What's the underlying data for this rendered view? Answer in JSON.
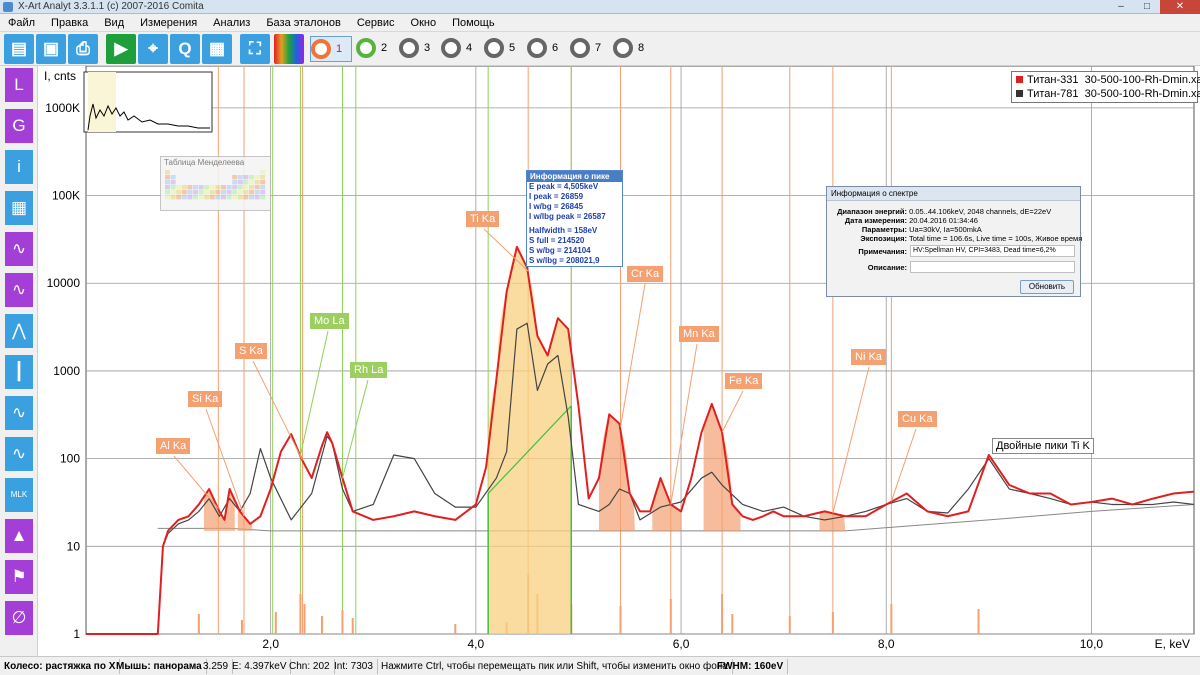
{
  "window": {
    "title": "X-Art Analyt 3.3.1.1 (c) 2007-2016 Comita",
    "min": "–",
    "max": "□",
    "close": "✕"
  },
  "menu": [
    "Файл",
    "Правка",
    "Вид",
    "Измерения",
    "Анализ",
    "База эталонов",
    "Сервис",
    "Окно",
    "Помощь"
  ],
  "toolbar": {
    "icons": [
      "open-folder-icon",
      "save-icon",
      "print-icon",
      "play-icon",
      "target-icon",
      "search-q-icon",
      "calculator-icon",
      "fullscreen-icon",
      "color-palette-icon"
    ],
    "glyphs": [
      "▤",
      "▣",
      "⎙",
      "▶",
      "⌖",
      "Q",
      "▦",
      "⛶",
      "█"
    ],
    "spectra": [
      {
        "num": "1",
        "color": "orange",
        "selected": true
      },
      {
        "num": "2",
        "color": "green",
        "selected": false
      },
      {
        "num": "3",
        "color": "gray",
        "selected": false
      },
      {
        "num": "4",
        "color": "gray",
        "selected": false
      },
      {
        "num": "5",
        "color": "gray",
        "selected": false
      },
      {
        "num": "6",
        "color": "gray",
        "selected": false
      },
      {
        "num": "7",
        "color": "gray",
        "selected": false
      },
      {
        "num": "8",
        "color": "gray",
        "selected": false
      }
    ]
  },
  "sidebar": {
    "buttons": [
      {
        "label": "L",
        "icon": "l-button-icon",
        "color": "purple"
      },
      {
        "label": "G",
        "icon": "g-button-icon",
        "color": "purple"
      },
      {
        "label": "i",
        "icon": "info-icon",
        "color": "blue"
      },
      {
        "label": "▦",
        "icon": "table-icon",
        "color": "blue"
      },
      {
        "label": "∿",
        "icon": "peak-icon",
        "color": "purple"
      },
      {
        "label": "∿",
        "icon": "peak-line-icon",
        "color": "purple"
      },
      {
        "label": "⋀",
        "icon": "peak-markers-icon",
        "color": "blue"
      },
      {
        "label": "┃",
        "icon": "bars-icon",
        "color": "blue"
      },
      {
        "label": "∿",
        "icon": "peak-fill-icon",
        "color": "blue"
      },
      {
        "label": "∿",
        "icon": "peak-outline-icon",
        "color": "blue"
      },
      {
        "label": "MLK",
        "icon": "mlk-lines-icon",
        "color": "blue"
      },
      {
        "label": "▲",
        "icon": "area-icon",
        "color": "purple"
      },
      {
        "label": "⚑",
        "icon": "flag-icon",
        "color": "purple"
      },
      {
        "label": "∅",
        "icon": "no-marker-icon",
        "color": "purple"
      }
    ]
  },
  "legend": [
    {
      "name": "Титан-331",
      "file": "30-500-100-Rh-Dmin.xart",
      "color": "#e02020"
    },
    {
      "name": "Титан-781",
      "file": "30-500-100-Rh-Dmin.xart",
      "color": "#333333"
    }
  ],
  "periodic_table": {
    "title": "Таблица Менделеева"
  },
  "peak_info": {
    "title": "Информация о пике",
    "lines": [
      "E peak = 4,505keV",
      "I peak = 26859",
      "I w/bg = 26845",
      "I w/lbg peak = 26587",
      "Halfwidth = 158eV",
      "S full = 214520",
      "S w/bg = 214104",
      "S w/lbg = 208021,9"
    ]
  },
  "spectrum_info": {
    "title": "Информация о спектре",
    "rows": [
      {
        "label": "Диапазон энергий:",
        "value": "0.05..44.106keV, 2048 channels, dE=22eV"
      },
      {
        "label": "Дата измерения:",
        "value": "20.04.2016 01:34:46"
      },
      {
        "label": "Параметры:",
        "value": "Ua=30kV, Ia=500mkA"
      },
      {
        "label": "Экспозиция:",
        "value": "Total time = 106.6s, Live time = 100s, Живое время"
      }
    ],
    "notes_label": "Примечания:",
    "notes_value": "HV:Spellman HV, CPI=3483, Dead time=6,2%",
    "desc_label": "Описание:",
    "desc_value": "",
    "update_button": "Обновить"
  },
  "statusbar": [
    "Колесо: растяжка по Х",
    "Мышь: панорама",
    "3.259",
    "E: 4.397keV",
    "Chn: 202",
    "Int: 7303",
    "Нажмите Ctrl, чтобы перемещать пик или Shift, чтобы изменить окно фона",
    "FWHM: 160eV"
  ],
  "chart_data": {
    "type": "line",
    "xlabel": "E, keV",
    "ylabel": "I, cnts",
    "xlim": [
      0.2,
      11.0
    ],
    "ylim": [
      1,
      3000000
    ],
    "yscale": "log",
    "xticks": [
      2.0,
      4.0,
      6.0,
      8.0,
      10.0
    ],
    "xtick_labels": [
      "2,0",
      "4,0",
      "6,0",
      "8,0",
      "10,0"
    ],
    "yticks": [
      1,
      10,
      100,
      1000,
      10000,
      100000,
      1000000
    ],
    "ytick_labels": [
      "1",
      "10",
      "100",
      "1000",
      "10000",
      "100K",
      "1000K"
    ],
    "grid": true,
    "legend_position": "top-right",
    "series": [
      {
        "name": "Титан-331",
        "color": "#e02020",
        "x": [
          0.2,
          0.9,
          0.95,
          1.0,
          1.1,
          1.2,
          1.3,
          1.4,
          1.5,
          1.55,
          1.6,
          1.7,
          1.8,
          1.9,
          2.0,
          2.1,
          2.2,
          2.3,
          2.4,
          2.5,
          2.55,
          2.6,
          2.7,
          2.8,
          3.0,
          3.2,
          3.4,
          3.6,
          3.8,
          4.0,
          4.1,
          4.2,
          4.3,
          4.4,
          4.5,
          4.6,
          4.7,
          4.8,
          4.9,
          5.0,
          5.1,
          5.2,
          5.3,
          5.4,
          5.5,
          5.6,
          5.7,
          5.8,
          5.9,
          6.0,
          6.1,
          6.2,
          6.3,
          6.4,
          6.5,
          6.6,
          6.7,
          6.8,
          6.9,
          7.0,
          7.2,
          7.4,
          7.6,
          7.8,
          8.0,
          8.2,
          8.4,
          8.6,
          8.8,
          9.0,
          9.2,
          9.4,
          9.6,
          9.8,
          10.0,
          10.2,
          10.4,
          10.6,
          10.8,
          11.0
        ],
        "y": [
          1,
          1,
          10,
          15,
          20,
          22,
          30,
          45,
          25,
          20,
          45,
          25,
          18,
          22,
          45,
          120,
          190,
          100,
          60,
          140,
          200,
          150,
          60,
          25,
          20,
          22,
          25,
          22,
          20,
          30,
          80,
          800,
          8000,
          26000,
          15000,
          2500,
          1500,
          4000,
          3000,
          400,
          35,
          60,
          320,
          250,
          40,
          25,
          25,
          60,
          30,
          25,
          60,
          200,
          420,
          200,
          30,
          22,
          20,
          22,
          25,
          22,
          22,
          25,
          22,
          22,
          30,
          40,
          25,
          22,
          25,
          110,
          50,
          40,
          40,
          30,
          32,
          35,
          30,
          35,
          40,
          42
        ]
      },
      {
        "name": "Титан-781",
        "color": "#444444",
        "x": [
          0.2,
          0.9,
          0.95,
          1.0,
          1.1,
          1.2,
          1.3,
          1.4,
          1.5,
          1.6,
          1.7,
          1.8,
          1.9,
          2.0,
          2.2,
          2.4,
          2.55,
          2.6,
          2.7,
          2.8,
          3.0,
          3.2,
          3.4,
          3.6,
          3.8,
          4.0,
          4.2,
          4.3,
          4.4,
          4.5,
          4.6,
          4.7,
          4.8,
          4.9,
          5.0,
          5.2,
          5.3,
          5.4,
          5.5,
          5.6,
          5.8,
          6.0,
          6.2,
          6.3,
          6.4,
          6.6,
          6.8,
          7.0,
          7.2,
          7.4,
          7.6,
          7.8,
          8.0,
          8.2,
          8.4,
          8.6,
          8.8,
          9.0,
          9.2,
          9.4,
          9.6,
          9.8,
          10.0,
          10.2,
          10.4,
          10.6,
          10.8,
          11.0
        ],
        "y": [
          1,
          1,
          10,
          14,
          18,
          20,
          25,
          35,
          22,
          35,
          25,
          40,
          130,
          60,
          20,
          40,
          180,
          150,
          45,
          25,
          30,
          110,
          100,
          40,
          28,
          28,
          60,
          120,
          3000,
          3500,
          600,
          1200,
          1500,
          300,
          30,
          25,
          30,
          45,
          40,
          20,
          28,
          32,
          60,
          70,
          50,
          30,
          25,
          28,
          22,
          20,
          22,
          25,
          30,
          35,
          25,
          24,
          45,
          100,
          45,
          40,
          35,
          30,
          32,
          30,
          30,
          30,
          32,
          30
        ]
      }
    ],
    "peak_labels": [
      {
        "name": "Al Ka",
        "x": 1.49,
        "kind": "element"
      },
      {
        "name": "Si Ka",
        "x": 1.74,
        "kind": "element"
      },
      {
        "name": "S Ka",
        "x": 2.31,
        "kind": "element"
      },
      {
        "name": "Mo La",
        "x": 2.29,
        "kind": "line"
      },
      {
        "name": "Rh La",
        "x": 2.7,
        "kind": "line"
      },
      {
        "name": "Ti Ka",
        "x": 4.51,
        "kind": "element"
      },
      {
        "name": "Cr Ka",
        "x": 5.41,
        "kind": "element"
      },
      {
        "name": "Mn Ka",
        "x": 5.9,
        "kind": "element"
      },
      {
        "name": "Fe Ka",
        "x": 6.4,
        "kind": "element"
      },
      {
        "name": "Ni Ka",
        "x": 7.48,
        "kind": "element"
      },
      {
        "name": "Cu Ka",
        "x": 8.05,
        "kind": "element"
      }
    ],
    "annotation": "Двойные пики Ti K"
  }
}
